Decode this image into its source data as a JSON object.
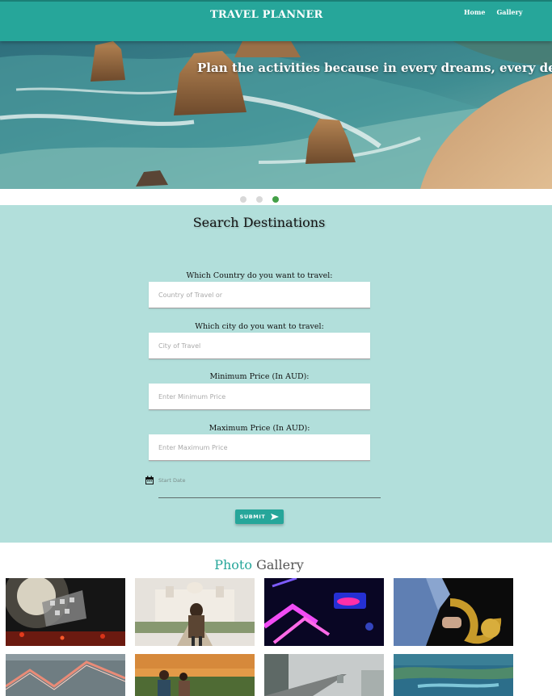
{
  "header": {
    "brand": "TRAVEL PLANNER",
    "nav": [
      "Home",
      "Gallery"
    ]
  },
  "hero": {
    "caption": "Plan the activities because in every dreams, every detail m",
    "slides_total": 3,
    "active_slide": 3
  },
  "search": {
    "title": "Search Destinations",
    "fields": [
      {
        "label": "Which Country do you want to travel:",
        "placeholder": "Country of Travel or",
        "value": ""
      },
      {
        "label": "Which city do you want to travel:",
        "placeholder": "City of Travel",
        "value": ""
      },
      {
        "label": "Minimum Price (In AUD):",
        "placeholder": "Enter Minimum Price",
        "value": ""
      },
      {
        "label": "Maximum Price (In AUD):",
        "placeholder": "Enter Maximum Price",
        "value": ""
      }
    ],
    "date_placeholder": "Start Date",
    "submit_label": "SUBMIT"
  },
  "gallery": {
    "title_accent": "Photo",
    "title_rest": "Gallery",
    "photos": [
      "concert-photo",
      "palace-photo",
      "neon-lights-photo",
      "saxophone-photo",
      "stairs-photo",
      "sunset-people-photo",
      "foggy-road-photo",
      "lake-town-photo"
    ]
  },
  "colors": {
    "primary": "#26a69a",
    "search_bg": "#b2dfdb",
    "active_dot": "#43a047"
  }
}
